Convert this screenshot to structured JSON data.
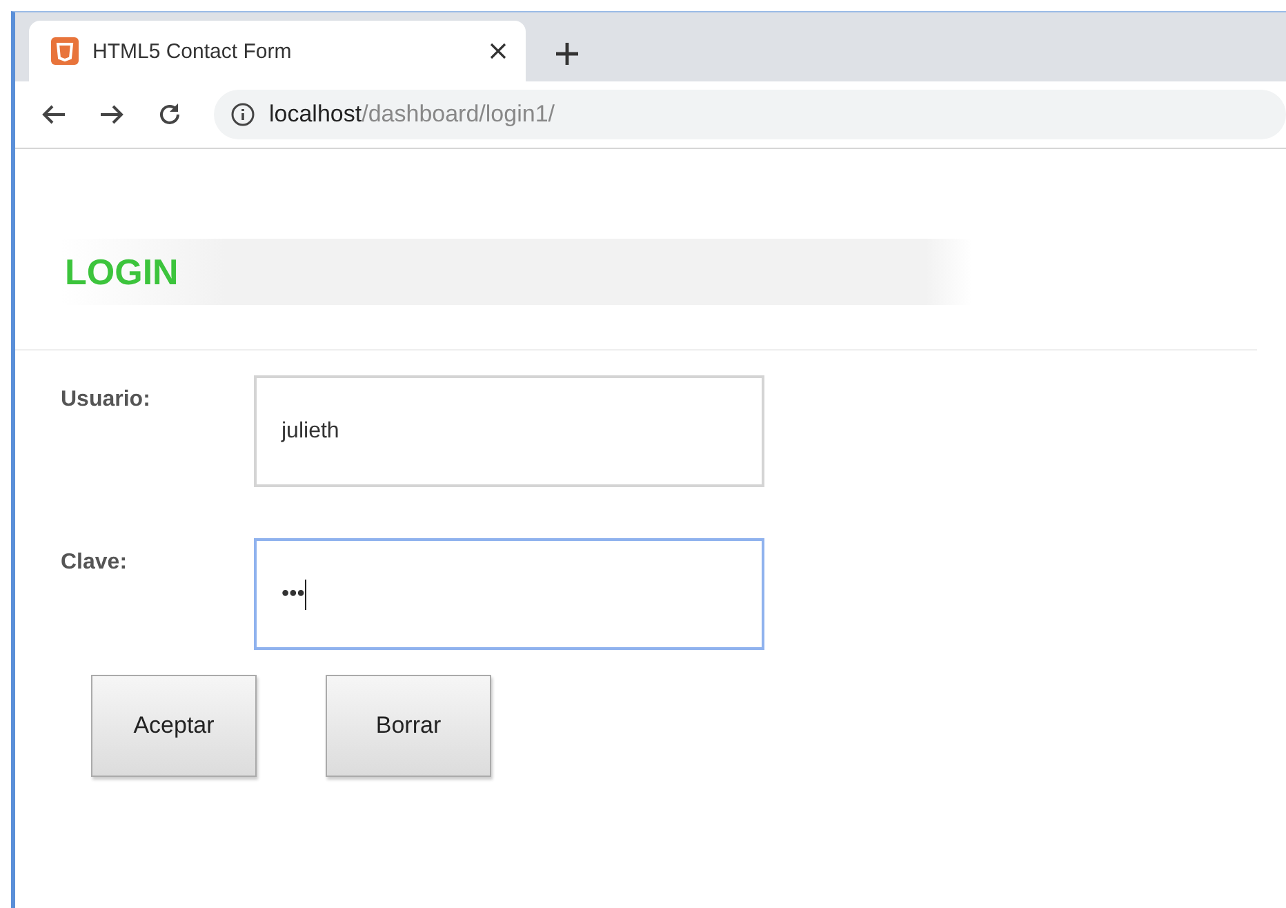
{
  "browser": {
    "tab": {
      "title": "HTML5 Contact Form",
      "selected": true
    },
    "address": {
      "host": "localhost",
      "path": "/dashboard/login1/"
    }
  },
  "page": {
    "heading": "LOGIN",
    "fields": [
      {
        "label": "Usuario:",
        "value": "julieth",
        "focused": false
      },
      {
        "label": "Clave:",
        "value": "•••",
        "focused": true
      }
    ],
    "buttons": [
      "Aceptar",
      "Borrar"
    ]
  }
}
